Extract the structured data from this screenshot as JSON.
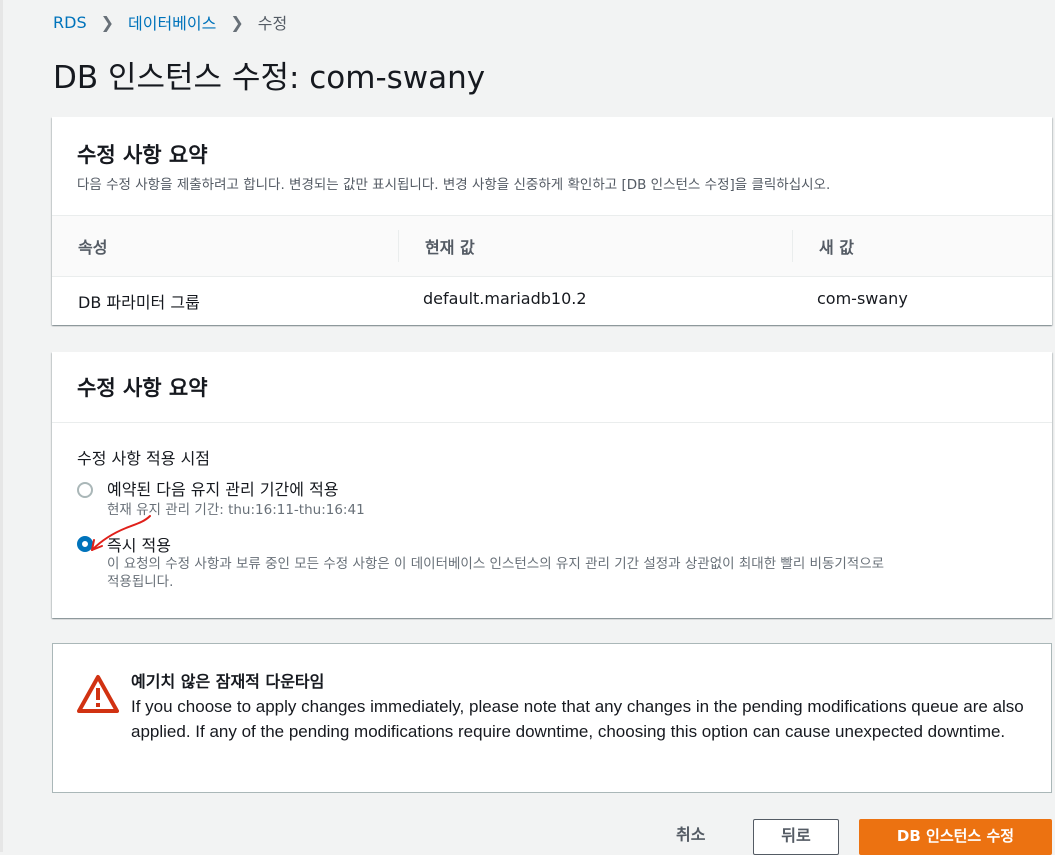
{
  "breadcrumb": {
    "items": [
      "RDS",
      "데이터베이스"
    ],
    "current": "수정"
  },
  "page_title": "DB 인스턴스 수정: com-swany",
  "summary_panel": {
    "title": "수정 사항 요약",
    "description": "다음 수정 사항을 제출하려고 합니다. 변경되는 값만 표시됩니다. 변경 사항을 신중하게 확인하고 [DB 인스턴스 수정]을 클릭하십시오.",
    "columns": [
      "속성",
      "현재 값",
      "새 값"
    ],
    "rows": [
      {
        "attribute": "DB 파라미터 그룹",
        "current": "default.mariadb10.2",
        "new": "com-swany"
      }
    ]
  },
  "schedule_panel": {
    "title": "수정 사항 요약",
    "label": "수정 사항 적용 시점",
    "options": [
      {
        "label": "예약된 다음 유지 관리 기간에 적용",
        "desc": "현재 유지 관리 기간: thu:16:11-thu:16:41",
        "selected": false
      },
      {
        "label": "즉시 적용",
        "desc_line1": "이 요청의 수정 사항과 보류 중인 모든 수정 사항은 이 데이터베이스 인스턴스의 유지 관리 기간 설정과 상관없이 최대한 빨리 비동기적으로",
        "desc_line2": "적용됩니다.",
        "selected": true
      }
    ]
  },
  "warning": {
    "icon": "warning-icon",
    "title": "예기치 않은 잠재적 다운타임",
    "body": "If you choose to apply changes immediately, please note that any changes in the pending modifications queue are also applied. If any of the pending modifications require downtime, choosing this option can cause unexpected downtime."
  },
  "actions": {
    "cancel": "취소",
    "back": "뒤로",
    "submit": "DB 인스턴스 수정"
  },
  "colors": {
    "link": "#0073bb",
    "primary": "#ec7211",
    "radio_selected": "#0073bb",
    "warning_red": "#d13212",
    "annotation": "#e0201a"
  }
}
